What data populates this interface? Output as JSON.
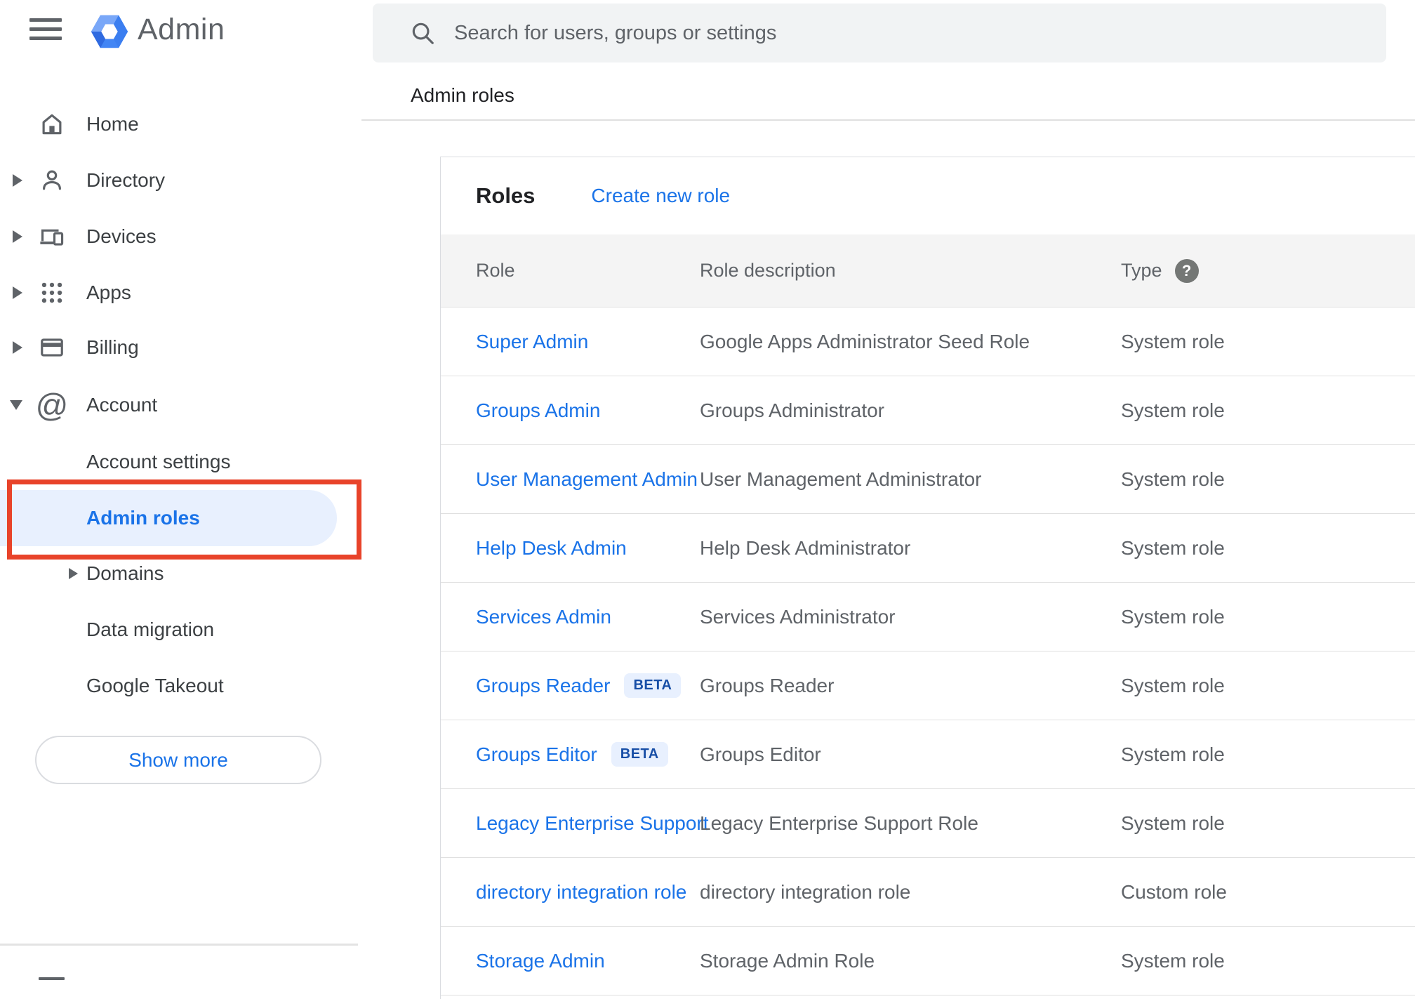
{
  "header": {
    "product_name": "Admin",
    "search_placeholder": "Search for users, groups or settings"
  },
  "sidebar": {
    "items": [
      {
        "label": "Home",
        "icon": "home-icon",
        "expandable": false
      },
      {
        "label": "Directory",
        "icon": "person-icon",
        "expandable": true
      },
      {
        "label": "Devices",
        "icon": "devices-icon",
        "expandable": true
      },
      {
        "label": "Apps",
        "icon": "apps-grid-icon",
        "expandable": true
      },
      {
        "label": "Billing",
        "icon": "credit-card-icon",
        "expandable": true
      },
      {
        "label": "Account",
        "icon": "at-sign-icon",
        "expandable": true,
        "expanded": true
      }
    ],
    "account_sub_items": [
      {
        "label": "Account settings",
        "active": false
      },
      {
        "label": "Admin roles",
        "active": true,
        "annotated": true
      },
      {
        "label": "Domains",
        "active": false,
        "expandable": true
      },
      {
        "label": "Data migration",
        "active": false
      },
      {
        "label": "Google Takeout",
        "active": false
      }
    ],
    "show_more_label": "Show more"
  },
  "breadcrumb": "Admin roles",
  "main": {
    "card_title": "Roles",
    "create_link_label": "Create new role",
    "table": {
      "columns": {
        "role": "Role",
        "description": "Role description",
        "type": "Type"
      },
      "help_icon": "?",
      "rows": [
        {
          "role": "Super Admin",
          "description": "Google Apps Administrator Seed Role",
          "type": "System role"
        },
        {
          "role": "Groups Admin",
          "description": "Groups Administrator",
          "type": "System role"
        },
        {
          "role": "User Management Admin",
          "description": "User Management Administrator",
          "type": "System role"
        },
        {
          "role": "Help Desk Admin",
          "description": "Help Desk Administrator",
          "type": "System role"
        },
        {
          "role": "Services Admin",
          "description": "Services Administrator",
          "type": "System role"
        },
        {
          "role": "Groups Reader",
          "badge": "BETA",
          "description": "Groups Reader",
          "type": "System role"
        },
        {
          "role": "Groups Editor",
          "badge": "BETA",
          "description": "Groups Editor",
          "type": "System role"
        },
        {
          "role": "Legacy Enterprise Support",
          "description": "Legacy Enterprise Support Role",
          "type": "System role"
        },
        {
          "role": "directory integration role",
          "description": "directory integration role",
          "type": "Custom role"
        },
        {
          "role": "Storage Admin",
          "description": "Storage Admin Role",
          "type": "System role"
        }
      ]
    }
  },
  "colors": {
    "accent_blue": "#1a73e8",
    "active_pill_bg": "#e8f0fe",
    "annotation_red": "#e8432a",
    "icon_gray": "#5f6368",
    "table_header_bg": "#f4f4f4",
    "search_bg": "#f1f3f4",
    "beta_text": "#174ea6",
    "logo_blue": "#4285f4"
  }
}
